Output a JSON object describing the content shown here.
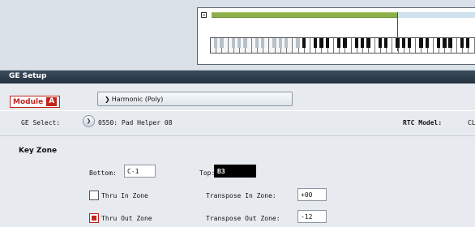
{
  "window": {
    "title": "GE Setup"
  },
  "module": {
    "label": "Module",
    "letter": "A"
  },
  "program": {
    "label": "Harmonic (Poly)"
  },
  "ge_select": {
    "label": "GE Select:",
    "value": "0550: Pad Helper 08"
  },
  "rtc_model": {
    "label": "RTC Model:",
    "value": "CL"
  },
  "key_zone": {
    "title": "Key Zone",
    "bottom_label": "Bottom:",
    "bottom_value": "C-1",
    "top_label": "Top:",
    "top_value": "B3",
    "thru_in_zone": {
      "label": "Thru In Zone",
      "checked": false
    },
    "thru_out_zone": {
      "label": "Thru Out Zone",
      "checked": true
    },
    "transpose_in_label": "Transpose In Zone:",
    "transpose_in_value": "+00",
    "transpose_out_label": "Transpose Out Zone:",
    "transpose_out_value": "-12"
  },
  "colors": {
    "accent": "#c0241c",
    "header": "#2b3947",
    "range_bar": "#8eb04a"
  }
}
